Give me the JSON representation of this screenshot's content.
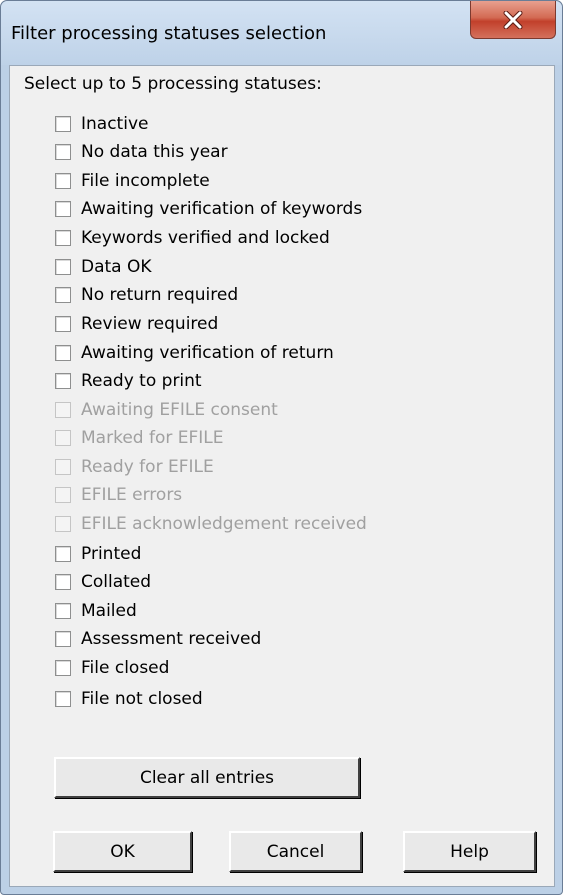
{
  "window": {
    "title": "Filter processing statuses selection",
    "close_icon": "close-icon",
    "accent_close": "#c7432d"
  },
  "prompt": "Select up to 5 processing statuses:",
  "statuses": [
    {
      "label": "Inactive",
      "checked": false,
      "enabled": true
    },
    {
      "label": "No data this year",
      "checked": false,
      "enabled": true
    },
    {
      "label": "File incomplete",
      "checked": false,
      "enabled": true
    },
    {
      "label": "Awaiting verification of keywords",
      "checked": false,
      "enabled": true
    },
    {
      "label": "Keywords verified and locked",
      "checked": false,
      "enabled": true
    },
    {
      "label": "Data OK",
      "checked": false,
      "enabled": true
    },
    {
      "label": "No return required",
      "checked": false,
      "enabled": true
    },
    {
      "label": "Review required",
      "checked": false,
      "enabled": true
    },
    {
      "label": "Awaiting verification of return",
      "checked": false,
      "enabled": true
    },
    {
      "label": "Ready to print",
      "checked": false,
      "enabled": true
    },
    {
      "label": "Awaiting EFILE consent",
      "checked": false,
      "enabled": false
    },
    {
      "label": "Marked for EFILE",
      "checked": false,
      "enabled": false
    },
    {
      "label": "Ready for EFILE",
      "checked": false,
      "enabled": false
    },
    {
      "label": "EFILE errors",
      "checked": false,
      "enabled": false
    },
    {
      "label": "EFILE acknowledgement received",
      "checked": false,
      "enabled": false
    },
    {
      "label": "Printed",
      "checked": false,
      "enabled": true
    },
    {
      "label": "Collated",
      "checked": false,
      "enabled": true
    },
    {
      "label": "Mailed",
      "checked": false,
      "enabled": true
    },
    {
      "label": "Assessment received",
      "checked": false,
      "enabled": true
    },
    {
      "label": "File closed",
      "checked": false,
      "enabled": true
    },
    {
      "label": "File not closed",
      "checked": false,
      "enabled": true
    }
  ],
  "buttons": {
    "clear": "Clear all entries",
    "ok": "OK",
    "cancel": "Cancel",
    "help": "Help"
  }
}
